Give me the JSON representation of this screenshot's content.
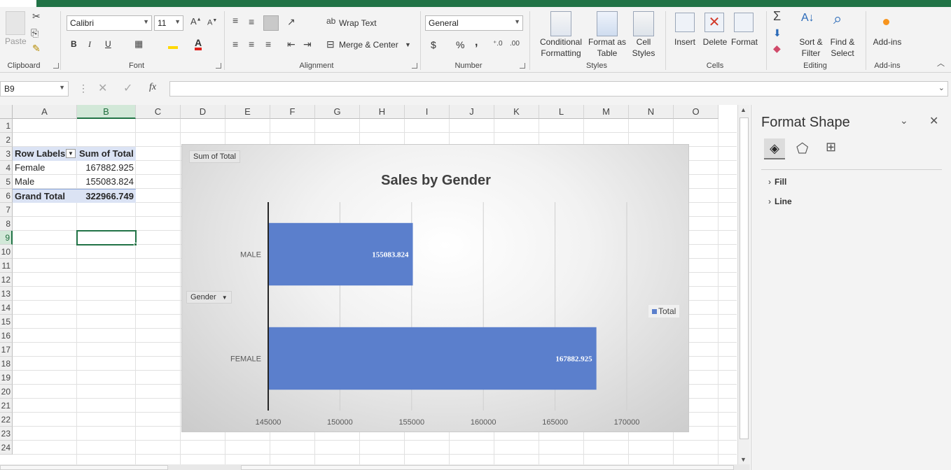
{
  "ribbon": {
    "clipboard": {
      "paste": "Paste",
      "group": "Clipboard"
    },
    "font": {
      "name": "Calibri",
      "size": "11",
      "group": "Font",
      "bold": "B",
      "italic": "I",
      "underline": "U"
    },
    "alignment": {
      "wrap_text": "Wrap Text",
      "merge_center": "Merge & Center",
      "group": "Alignment"
    },
    "number": {
      "format": "General",
      "currency": "$",
      "percent": "%",
      "comma": ",",
      "group": "Number"
    },
    "styles": {
      "conditional_1": "Conditional",
      "conditional_2": "Formatting",
      "format_table_1": "Format as",
      "format_table_2": "Table",
      "cell_styles_1": "Cell",
      "cell_styles_2": "Styles",
      "group": "Styles"
    },
    "cells": {
      "insert": "Insert",
      "delete": "Delete",
      "format": "Format",
      "group": "Cells"
    },
    "editing": {
      "sort_1": "Sort &",
      "sort_2": "Filter",
      "find_1": "Find &",
      "find_2": "Select",
      "group": "Editing"
    },
    "addins": {
      "label": "Add-ins",
      "group": "Add-ins"
    }
  },
  "formula_bar": {
    "name_box": "B9",
    "fx": "fx",
    "formula": ""
  },
  "columns": [
    "A",
    "B",
    "C",
    "D",
    "E",
    "F",
    "G",
    "H",
    "I",
    "J",
    "K",
    "L",
    "M",
    "N",
    "O"
  ],
  "selected_column": "B",
  "rows": [
    "1",
    "2",
    "3",
    "4",
    "5",
    "6",
    "7",
    "8",
    "9",
    "10",
    "11",
    "12",
    "13",
    "14",
    "15",
    "16",
    "17",
    "18",
    "19",
    "20",
    "21",
    "22",
    "23",
    "24"
  ],
  "selected_row": "9",
  "pivot": {
    "header_row_labels": "Row Labels",
    "header_sum": "Sum of Total",
    "rows": [
      {
        "label": "Female",
        "value": "167882.925"
      },
      {
        "label": "Male",
        "value": "155083.824"
      }
    ],
    "grand_total_label": "Grand Total",
    "grand_total_value": "322966.749"
  },
  "chart_data": {
    "type": "bar",
    "orientation": "horizontal",
    "title": "Sales by Gender",
    "field_button_value": "Sum of Total",
    "field_button_axis": "Gender",
    "categories": [
      "MALE",
      "FEMALE"
    ],
    "series": [
      {
        "name": "Total",
        "values": [
          155083.824,
          167882.925
        ]
      }
    ],
    "data_labels": [
      "155083.824",
      "167882.925"
    ],
    "xlim": [
      145000,
      170000
    ],
    "xticks": [
      "145000",
      "150000",
      "155000",
      "160000",
      "165000",
      "170000"
    ],
    "xtick_values": [
      145000,
      150000,
      155000,
      160000,
      165000,
      170000
    ],
    "grid": true,
    "legend": "right",
    "bar_color": "#5b7fcc"
  },
  "format_pane": {
    "title": "Format Shape",
    "sections": [
      "Fill",
      "Line"
    ]
  }
}
